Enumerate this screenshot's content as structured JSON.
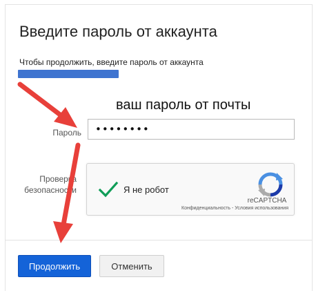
{
  "dialog": {
    "title": "Введите пароль от аккаунта",
    "subtitle": "Чтобы продолжить, введите пароль от аккаунта"
  },
  "annotation": {
    "text": "ваш пароль от почты",
    "arrow_color": "#e8403a"
  },
  "form": {
    "password_label": "Пароль",
    "password_value": "••••••••",
    "security_label_line1": "Проверка",
    "security_label_line2": "безопасности"
  },
  "recaptcha": {
    "label": "Я не робот",
    "brand": "reCAPTCHA",
    "privacy_link": "Конфиденциальность",
    "separator": " - ",
    "terms_link": "Условия использования",
    "check_color": "#109d58"
  },
  "actions": {
    "continue_label": "Продолжить",
    "cancel_label": "Отменить",
    "primary_color": "#1463d8"
  }
}
